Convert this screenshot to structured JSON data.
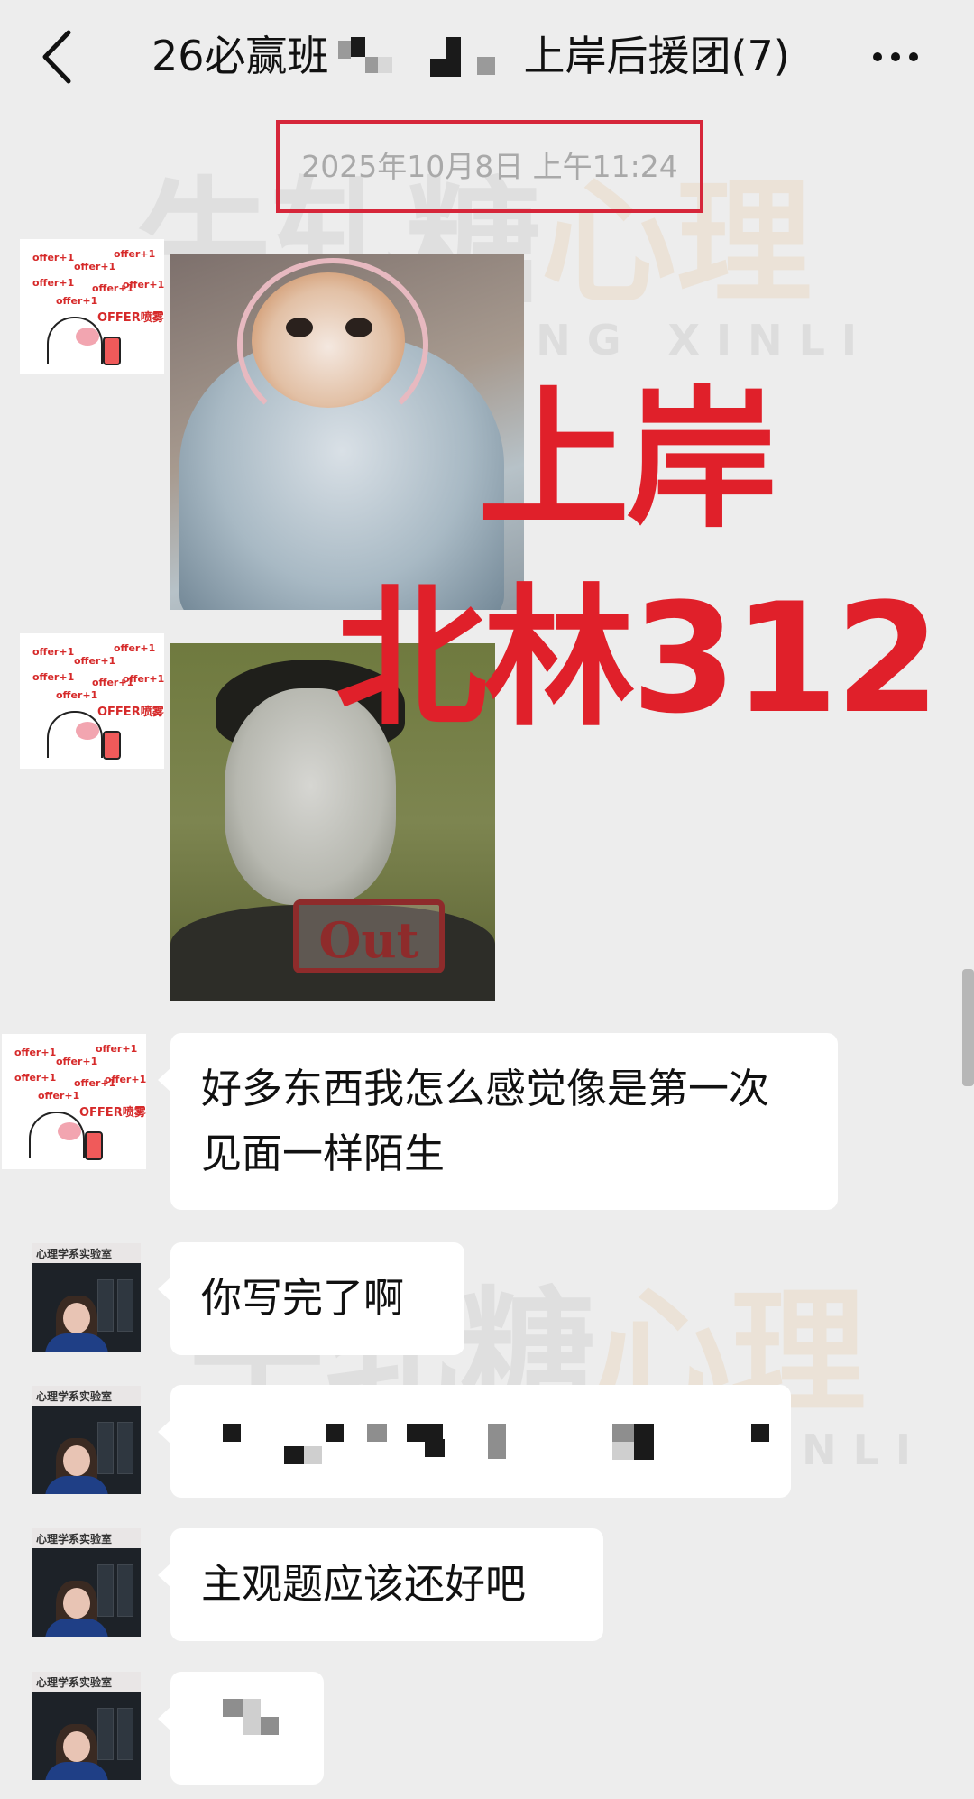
{
  "header": {
    "title_prefix": "26必赢班",
    "title_suffix": "上岸后援团(7)"
  },
  "timestamp": "2025年10月8日 上午11:24",
  "avatars": {
    "offer_sticker": {
      "texts": [
        "offer+1",
        "offer+1",
        "offer+1",
        "offer+1",
        "offer+1",
        "offer+1",
        "offer+1"
      ],
      "spray_label": "OFFER喷雾"
    },
    "lab_account_label": "心理学系实验室"
  },
  "messages": {
    "sticker_out_label": "Out",
    "m1": "好多东西我怎么感觉像是第一次见面一样陌生",
    "m2": "你写完了啊",
    "m4": "主观题应该还好吧"
  },
  "overlay": {
    "line1": "上岸",
    "line2": "北林312"
  },
  "watermark": {
    "cn_a": "牛轧糖",
    "cn_b": "心理",
    "en": "NIUZHATANG XINLI"
  },
  "colors": {
    "background": "#ededed",
    "overlay_red": "#e0202a",
    "timestamp_box": "#d6263a"
  }
}
